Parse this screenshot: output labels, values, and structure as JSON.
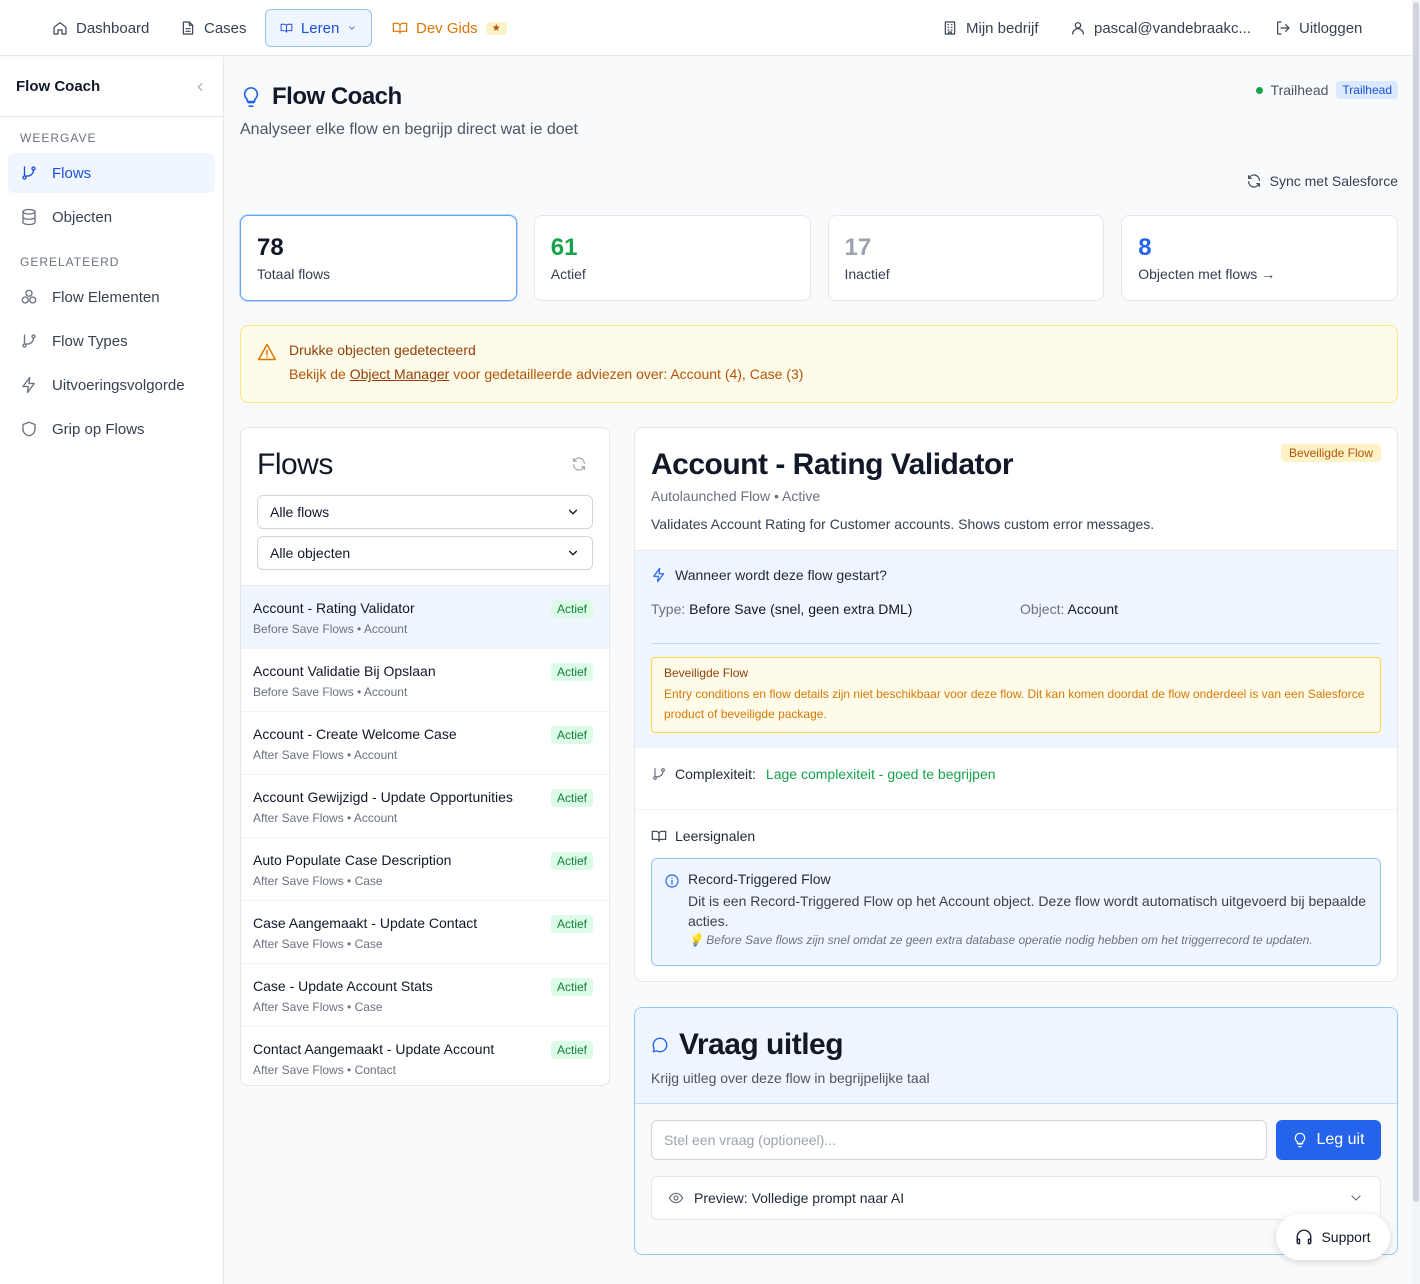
{
  "topnav": {
    "dashboard": "Dashboard",
    "cases": "Cases",
    "leren": "Leren",
    "devgids": "Dev Gids",
    "devgids_badge": "★",
    "company": "Mijn bedrijf",
    "user": "pascal@vandebraakc...",
    "logout": "Uitloggen"
  },
  "sidebar": {
    "title": "Flow Coach",
    "section1": "WEERGAVE",
    "section2": "GERELATEERD",
    "items": [
      "Flows",
      "Objecten",
      "Flow Elementen",
      "Flow Types",
      "Uitvoeringsvolgorde",
      "Grip op Flows"
    ]
  },
  "header": {
    "title": "Flow Coach",
    "subtitle": "Analyseer elke flow en begrijp direct wat ie doet",
    "trailhead": "Trailhead",
    "trailhead_badge": "Trailhead",
    "sync": "Sync met Salesforce"
  },
  "stats": [
    {
      "value": "78",
      "label": "Totaal flows",
      "color": "#111827"
    },
    {
      "value": "61",
      "label": "Actief",
      "color": "#16a34a"
    },
    {
      "value": "17",
      "label": "Inactief",
      "color": "#9ca3af"
    },
    {
      "value": "8",
      "label": "Objecten met flows →",
      "color": "#2563eb"
    }
  ],
  "warning": {
    "title": "Drukke objecten gedetecteerd",
    "prefix": "Bekijk de ",
    "link": "Object Manager",
    "suffix": " voor gedetailleerde adviezen over: Account (4), Case (3)"
  },
  "flows_panel": {
    "title": "Flows",
    "filter1": "Alle flows",
    "filter2": "Alle objecten",
    "items": [
      {
        "name": "Account - Rating Validator",
        "meta": "Before Save Flows • Account",
        "status": "Actief"
      },
      {
        "name": "Account Validatie Bij Opslaan",
        "meta": "Before Save Flows • Account",
        "status": "Actief"
      },
      {
        "name": "Account - Create Welcome Case",
        "meta": "After Save Flows • Account",
        "status": "Actief"
      },
      {
        "name": "Account Gewijzigd - Update Opportunities",
        "meta": "After Save Flows • Account",
        "status": "Actief"
      },
      {
        "name": "Auto Populate Case Description",
        "meta": "After Save Flows • Case",
        "status": "Actief"
      },
      {
        "name": "Case Aangemaakt - Update Contact",
        "meta": "After Save Flows • Case",
        "status": "Actief"
      },
      {
        "name": "Case - Update Account Stats",
        "meta": "After Save Flows • Case",
        "status": "Actief"
      },
      {
        "name": "Contact Aangemaakt - Update Account",
        "meta": "After Save Flows • Contact",
        "status": "Actief"
      }
    ]
  },
  "detail": {
    "title": "Account - Rating Validator",
    "badge": "Beveiligde Flow",
    "meta": "Autolaunched Flow • Active",
    "description": "Validates Account Rating for Customer accounts. Shows custom error messages.",
    "trigger_heading": "Wanneer wordt deze flow gestart?",
    "type_label": "Type:",
    "type_value": "Before Save (snel, geen extra DML)",
    "object_label": "Object:",
    "object_value": "Account",
    "secure_title": "Beveiligde Flow",
    "secure_text": "Entry conditions en flow details zijn niet beschikbaar voor deze flow. Dit kan komen doordat de flow onderdeel is van een Salesforce product of beveiligde package.",
    "complexity_label": "Complexiteit:",
    "complexity_value": "Lage complexiteit - goed te begrijpen",
    "learn_heading": "Leersignalen",
    "signal_title": "Record-Triggered Flow",
    "signal_text": "Dit is een Record-Triggered Flow op het Account object. Deze flow wordt automatisch uitgevoerd bij bepaalde acties.",
    "signal_tip": "💡 Before Save flows zijn snel omdat ze geen extra database operatie nodig hebben om het triggerrecord te updaten."
  },
  "ask": {
    "title": "Vraag uitleg",
    "subtitle": "Krijg uitleg over deze flow in begrijpelijke taal",
    "placeholder": "Stel een vraag (optioneel)...",
    "button": "Leg uit",
    "preview": "Preview: Volledige prompt naar AI"
  },
  "support": "Support"
}
